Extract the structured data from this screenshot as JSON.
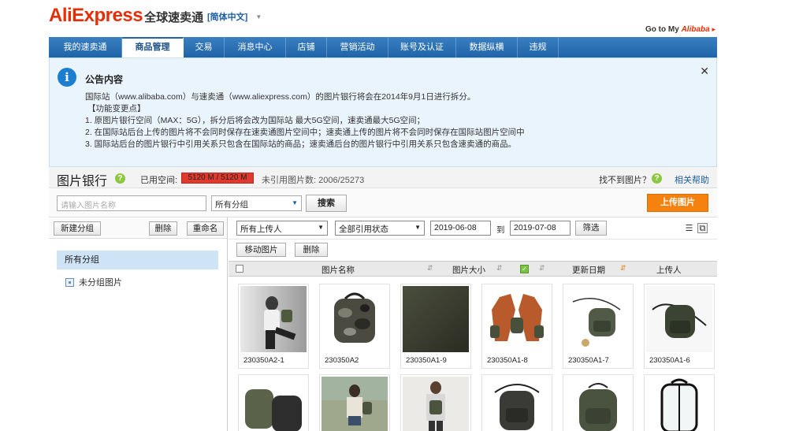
{
  "header": {
    "logo_text": "AliExpress",
    "logo_cn": "全球速卖通",
    "language": "[简体中文]",
    "goto_prefix": "Go to My",
    "goto_brand": "Alibaba"
  },
  "nav": [
    {
      "label": "我的速卖通",
      "width": 93
    },
    {
      "label": "商品管理",
      "width": 78,
      "active": true
    },
    {
      "label": "交易",
      "width": 52
    },
    {
      "label": "消息中心",
      "width": 78
    },
    {
      "label": "店铺",
      "width": 52
    },
    {
      "label": "营销活动",
      "width": 78
    },
    {
      "label": "账号及认证",
      "width": 86
    },
    {
      "label": "数据纵横",
      "width": 78
    },
    {
      "label": "违规",
      "width": 52
    }
  ],
  "notice": {
    "title": "公告内容",
    "line1": "国际站（www.alibaba.com）与速卖通（www.aliexpress.com）的图片银行将会在2014年9月1日进行拆分。",
    "header": "【功能变更点】",
    "item1": "1. 原图片银行空间（MAX：5G），拆分后将会改为国际站 最大5G空间，速卖通最大5G空间；",
    "item2": "2. 在国际站后台上传的图片将不会同时保存在速卖通图片空间中；速卖通上传的图片将不会同时保存在国际站图片空间中",
    "item3": "3. 国际站后台的图片银行中引用关系只包含在国际站的商品；速卖通后台的图片银行中引用关系只包含速卖通的商品。"
  },
  "bank": {
    "title": "图片银行",
    "used_label": "已用空间:",
    "used_value": "5120 M / 5120 M",
    "used_fraction": 1.0,
    "unused_text": "未引用图片数: 2006/25273",
    "notfound": "找不到图片？",
    "help": "相关帮助"
  },
  "search": {
    "placeholder": "请输入图片名称",
    "group_select": "所有分组",
    "search_btn": "搜索",
    "upload_btn": "上传图片"
  },
  "left": {
    "new_group": "新建分组",
    "delete": "删除",
    "rename": "重命名",
    "all_groups": "所有分组",
    "ungrouped": "未分组图片"
  },
  "filters": {
    "uploader": "所有上传人",
    "ref_status": "全部引用状态",
    "date_from": "2019-06-08",
    "to": "到",
    "date_to": "2019-07-08",
    "filter_btn": "筛选",
    "move_btn": "移动图片",
    "delete_btn": "删除"
  },
  "columns": {
    "name": "图片名称",
    "size": "图片大小",
    "updated": "更新日期",
    "uploader": "上传人"
  },
  "images": [
    {
      "name": "230350A2-1",
      "kind": "model-bw"
    },
    {
      "name": "230350A2",
      "kind": "camo-bag"
    },
    {
      "name": "230350A1-9",
      "kind": "olive-fabric"
    },
    {
      "name": "230350A1-8",
      "kind": "jacket-bags"
    },
    {
      "name": "230350A1-7",
      "kind": "bag-strap"
    },
    {
      "name": "230350A1-6",
      "kind": "bag-dark"
    }
  ],
  "images_row2": [
    {
      "kind": "two-bags"
    },
    {
      "kind": "model-street"
    },
    {
      "kind": "model-back"
    },
    {
      "kind": "black-backpack"
    },
    {
      "kind": "green-backpack"
    },
    {
      "kind": "clear-backpack"
    }
  ]
}
